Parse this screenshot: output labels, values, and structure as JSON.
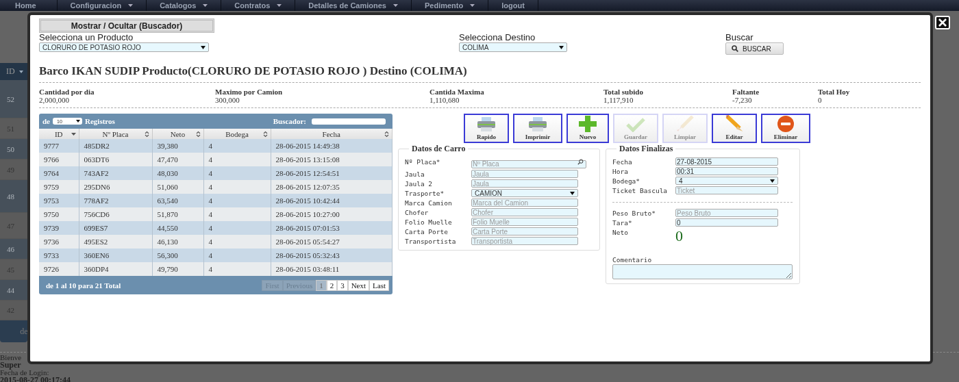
{
  "nav": [
    {
      "label": "Home",
      "dropdown": false
    },
    {
      "label": "Configuracion",
      "dropdown": true
    },
    {
      "label": "Catalogos",
      "dropdown": true
    },
    {
      "label": "Contratos",
      "dropdown": true
    },
    {
      "label": "Detalles de Camiones",
      "dropdown": true
    },
    {
      "label": "Pedimento",
      "dropdown": true
    },
    {
      "label": "logout",
      "dropdown": false
    }
  ],
  "background": {
    "id_header": "ID",
    "row_numbers": [
      "52",
      "51",
      "50",
      "49",
      "48",
      "47",
      "46",
      "45",
      "44",
      "42"
    ],
    "footer_text": "de",
    "welcome": "Bienve",
    "user": "Super",
    "login_label": "Fecha de Login:",
    "login_date": "2015-08-27 00:17:44"
  },
  "modal": {
    "toggle_button": "Mostrar / Ocultar (Buscador)",
    "filters": [
      {
        "label": "Selecciona un Producto",
        "value": "CLORURO DE POTASIO ROJO"
      },
      {
        "label": "Selecciona Destino",
        "value": "COLIMA"
      }
    ],
    "search_label": "Buscar",
    "search_button": "BUSCAR",
    "title": "Barco IKAN SUDIP Producto(CLORURO DE POTASIO ROJO ) Destino (COLIMA)",
    "stats": [
      {
        "label": "Cantidad por dia",
        "value": "2,000,000"
      },
      {
        "label": "Maximo por Camion",
        "value": "300,000"
      },
      {
        "label": "Cantida Maxima",
        "value": "1,110,680"
      },
      {
        "label": "Total subido",
        "value": "1,117,910"
      },
      {
        "label": "Faltante",
        "value": "-7,230"
      },
      {
        "label": "Total Hoy",
        "value": "0"
      }
    ],
    "table": {
      "length_prefix": "de",
      "page_size": "10",
      "length_suffix": "Registros",
      "search_label": "Buscador:",
      "columns": [
        {
          "label": "ID",
          "sorted": true
        },
        {
          "label": "Nº Placa",
          "sorted": false
        },
        {
          "label": "Neto",
          "sorted": false
        },
        {
          "label": "Bodega",
          "sorted": false
        },
        {
          "label": "Fecha",
          "sorted": false
        }
      ],
      "rows": [
        [
          "9777",
          "485DR2",
          "39,380",
          "4",
          "28-06-2015 14:49:38"
        ],
        [
          "9766",
          "063DT6",
          "47,470",
          "4",
          "28-06-2015 13:15:08"
        ],
        [
          "9764",
          "743AF2",
          "48,030",
          "4",
          "28-06-2015 12:54:51"
        ],
        [
          "9759",
          "295DN6",
          "51,060",
          "4",
          "28-06-2015 12:07:35"
        ],
        [
          "9753",
          "778AF2",
          "63,540",
          "4",
          "28-06-2015 10:42:44"
        ],
        [
          "9750",
          "756CD6",
          "51,870",
          "4",
          "28-06-2015 10:27:00"
        ],
        [
          "9739",
          "699ES7",
          "44,550",
          "4",
          "28-06-2015 07:01:53"
        ],
        [
          "9736",
          "495ES2",
          "46,130",
          "4",
          "28-06-2015 05:54:27"
        ],
        [
          "9733",
          "360EN6",
          "56,300",
          "4",
          "28-06-2015 05:32:43"
        ],
        [
          "9726",
          "360DP4",
          "49,790",
          "4",
          "28-06-2015 03:48:11"
        ]
      ],
      "info": "de 1 al 10 para 21 Total",
      "pages": [
        {
          "label": "First",
          "disabled": true,
          "selected": false
        },
        {
          "label": "Previous",
          "disabled": true,
          "selected": false
        },
        {
          "label": "1",
          "disabled": false,
          "selected": true
        },
        {
          "label": "2",
          "disabled": false,
          "selected": false
        },
        {
          "label": "3",
          "disabled": false,
          "selected": false
        },
        {
          "label": "Next",
          "disabled": false,
          "selected": false
        },
        {
          "label": "Last",
          "disabled": false,
          "selected": false
        }
      ]
    },
    "toolbar": [
      {
        "label": "Rapido",
        "kind": "print",
        "disabled": false
      },
      {
        "label": "Imprimir",
        "kind": "print",
        "disabled": false
      },
      {
        "label": "Nuevo",
        "kind": "add",
        "disabled": false
      },
      {
        "label": "Guardar",
        "kind": "save",
        "disabled": true
      },
      {
        "label": "Limpiar",
        "kind": "clear",
        "disabled": true
      },
      {
        "label": "Editar",
        "kind": "edit",
        "disabled": false
      },
      {
        "label": "Eliminar",
        "kind": "delete",
        "disabled": false
      }
    ],
    "panels": [
      {
        "title": "Datos de Carro",
        "fields": [
          {
            "label": "Nº Placa*",
            "kind": "search",
            "placeholder": "Nº Placa"
          },
          {
            "label": "Jaula",
            "kind": "text",
            "placeholder": "Jaula"
          },
          {
            "label": "Jaula 2",
            "kind": "text",
            "placeholder": "Jaula"
          },
          {
            "label": "Trasporte*",
            "kind": "select",
            "value": "CAMION"
          },
          {
            "label": "Marca Camion",
            "kind": "text",
            "placeholder": "Marca del Camion"
          },
          {
            "label": "Chofer",
            "kind": "text",
            "placeholder": "Chofer"
          },
          {
            "label": "Folio Muelle",
            "kind": "text",
            "placeholder": "Folio Muelle"
          },
          {
            "label": "Carta Porte",
            "kind": "text",
            "placeholder": "Carta Porte"
          },
          {
            "label": "Transportista",
            "kind": "text",
            "placeholder": "Transportista"
          }
        ]
      },
      {
        "title": "Datos Finalizas",
        "fields": [
          {
            "label": "Fecha",
            "kind": "text",
            "value": "27-08-2015"
          },
          {
            "label": "Hora",
            "kind": "text",
            "value": "00:31"
          },
          {
            "label": "Bodega*",
            "kind": "select",
            "value": "4"
          },
          {
            "label": "Ticket Bascula",
            "kind": "text",
            "placeholder": "Ticket"
          },
          {
            "kind": "divider"
          },
          {
            "label": "Peso Bruto*",
            "kind": "text",
            "placeholder": "Peso Bruto"
          },
          {
            "label": "Tara*",
            "kind": "text",
            "value": "0"
          },
          {
            "label": "Neto",
            "kind": "display",
            "value": "0"
          },
          {
            "label": "Comentario",
            "kind": "textarea"
          }
        ]
      }
    ]
  }
}
